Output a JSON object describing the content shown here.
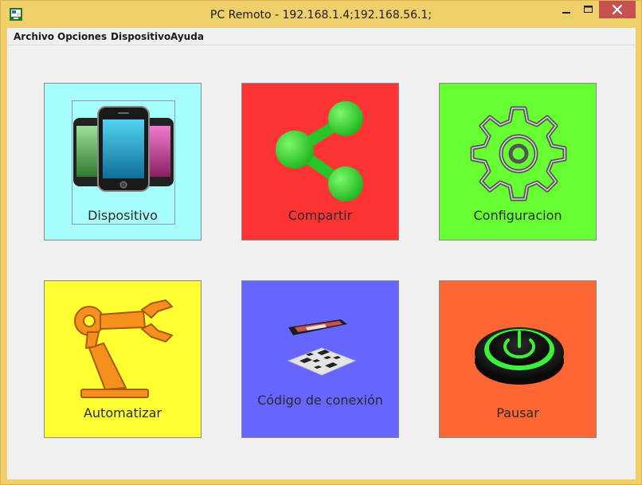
{
  "window": {
    "title": "PC Remoto - 192.168.1.4;192.168.56.1;",
    "app_icon": "pc-remote-app-icon",
    "controls": {
      "minimize": "minimize-icon",
      "maximize": "maximize-icon",
      "close": "close-icon"
    }
  },
  "menu": {
    "items": [
      {
        "label": "Archivo"
      },
      {
        "label": "Opciones"
      },
      {
        "label": "Dispositivo"
      },
      {
        "label": "Ayuda"
      }
    ]
  },
  "tiles": [
    {
      "label": "Dispositivo",
      "color": "#a6fdfd",
      "icon": "smartphones-icon"
    },
    {
      "label": "Compartir",
      "color": "#fe3333",
      "icon": "share-icon"
    },
    {
      "label": "Configuracion",
      "color": "#66fe33",
      "icon": "gear-icon"
    },
    {
      "label": "Automatizar",
      "color": "#fefe33",
      "icon": "robot-arm-icon"
    },
    {
      "label": "Código de conexión",
      "color": "#6666fe",
      "icon": "qr-code-phone-icon"
    },
    {
      "label": "Pausar",
      "color": "#fe6633",
      "icon": "power-button-icon"
    }
  ]
}
